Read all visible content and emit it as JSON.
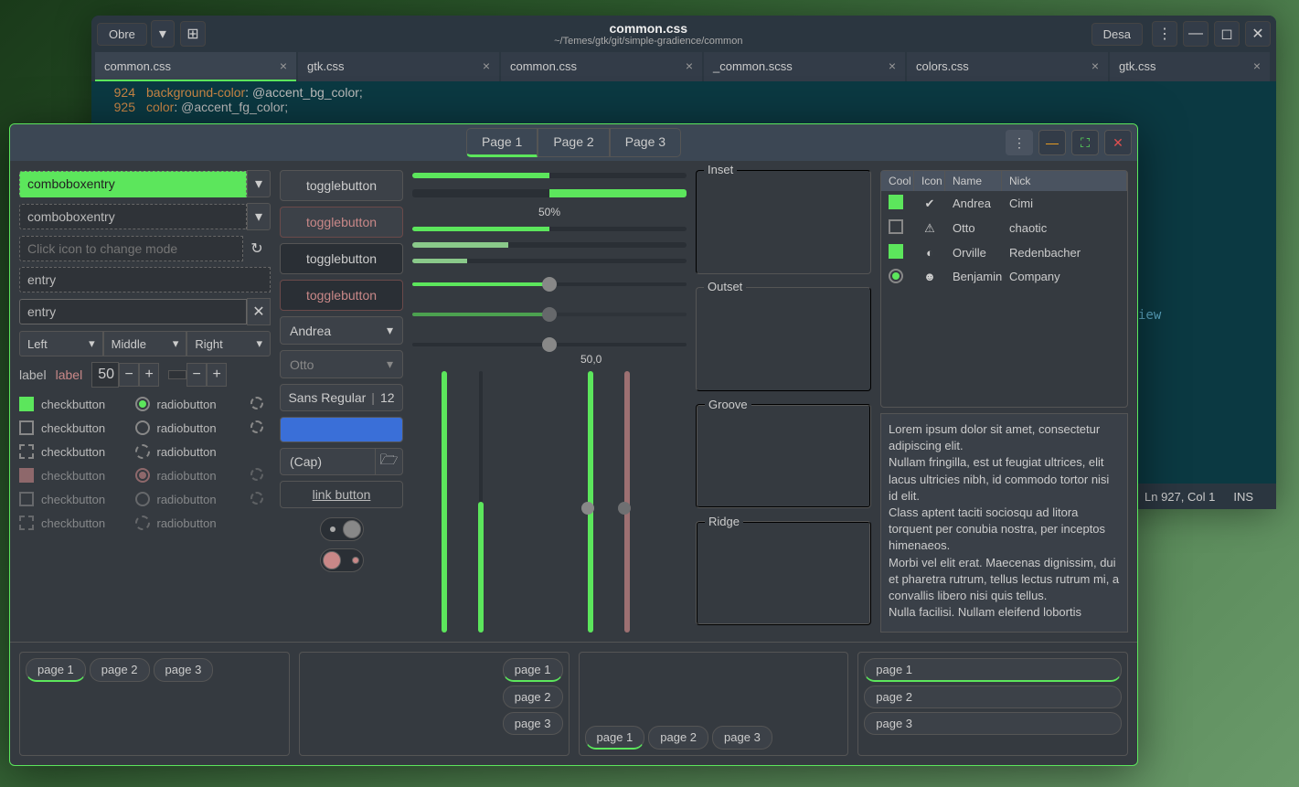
{
  "editor": {
    "open_btn": "Obre",
    "save_btn": "Desa",
    "title": "common.css",
    "subtitle": "~/Temes/gtk/git/simple-gradience/common",
    "tabs": [
      {
        "label": "common.css",
        "active": true
      },
      {
        "label": "gtk.css",
        "active": false
      },
      {
        "label": "common.css",
        "active": false
      },
      {
        "label": "_common.scss",
        "active": false
      },
      {
        "label": "colors.css",
        "active": false
      },
      {
        "label": "gtk.css",
        "active": false
      }
    ],
    "code": [
      {
        "num": "924",
        "prop": "background-color",
        "val": "@accent_bg_color;"
      },
      {
        "num": "925",
        "prop": "color",
        "val": "@accent_fg_color;"
      }
    ],
    "status_pos": "Ln 927, Col 1",
    "status_mode": "INS",
    "preview_text": "iew"
  },
  "dialog": {
    "tabs": [
      "Page 1",
      "Page 2",
      "Page 3"
    ],
    "col1": {
      "combo1": "comboboxentry",
      "combo2": "comboboxentry",
      "entry_icon": "Click icon to change mode",
      "entry3": "entry",
      "entry4": "entry",
      "triple": [
        "Left",
        "Middle",
        "Right"
      ],
      "label1": "label",
      "label2": "label",
      "spin_val": "50",
      "check_label": "checkbutton",
      "radio_label": "radiobutton"
    },
    "col2": {
      "toggle": "togglebutton",
      "combo_andrea": "Andrea",
      "combo_otto": "Otto",
      "font": "Sans Regular",
      "font_size": "12",
      "cap": "(Cap)",
      "link": "link button"
    },
    "col3": {
      "percent": "50%",
      "vscale_val": "50,0"
    },
    "col4": {
      "frames": [
        "Inset",
        "Outset",
        "Groove",
        "Ridge"
      ]
    },
    "col5": {
      "headers": [
        "Cool",
        "Icon",
        "Name",
        "Nick"
      ],
      "rows": [
        {
          "cool": "checked",
          "icon": "check",
          "name": "Andrea",
          "nick": "Cimi"
        },
        {
          "cool": "unchecked",
          "icon": "warn",
          "name": "Otto",
          "nick": "chaotic"
        },
        {
          "cool": "checked",
          "icon": "moon",
          "name": "Orville",
          "nick": "Redenbacher"
        },
        {
          "cool": "radio",
          "icon": "face",
          "name": "Benjamin",
          "nick": "Company"
        }
      ],
      "lorem": "Lorem ipsum dolor sit amet, consectetur adipiscing elit.\nNullam fringilla, est ut feugiat ultrices, elit lacus ultricies nibh, id commodo tortor nisi id elit.\nClass aptent taciti sociosqu ad litora torquent per conubia nostra, per inceptos himenaeos.\nMorbi vel elit erat. Maecenas dignissim, dui et pharetra rutrum, tellus lectus rutrum mi, a convallis libero nisi quis tellus.\nNulla facilisi. Nullam eleifend lobortis"
    },
    "footer_pages": [
      "page 1",
      "page 2",
      "page 3"
    ]
  }
}
